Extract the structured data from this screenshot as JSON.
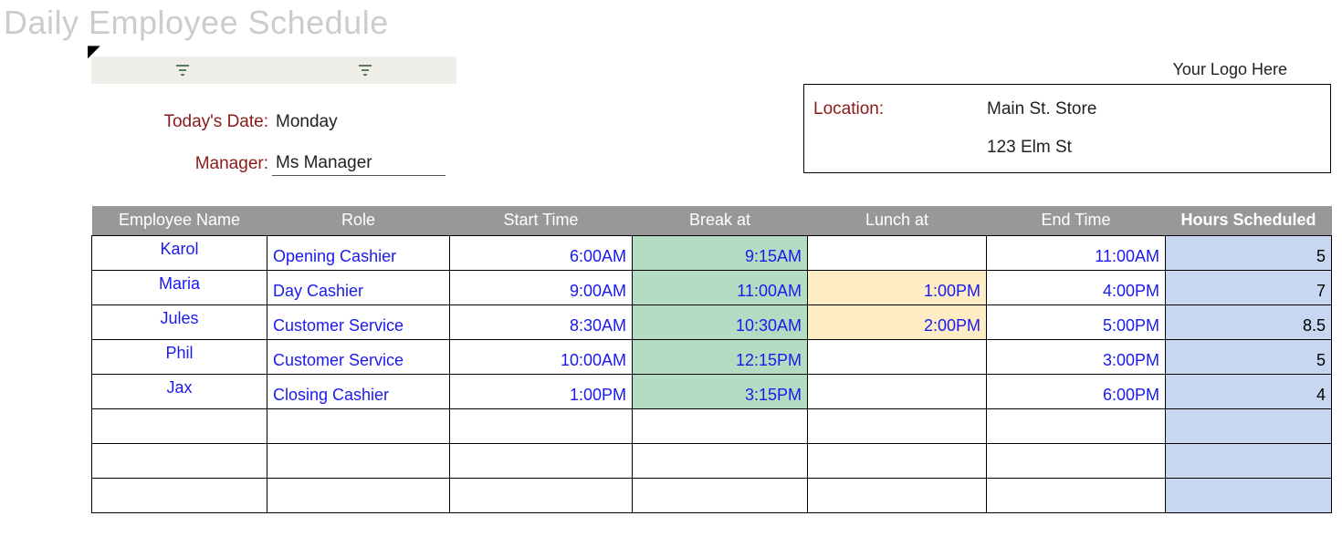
{
  "title": "Daily Employee Schedule",
  "logo_placeholder": "Your Logo Here",
  "info": {
    "date_label": "Today's Date:",
    "date_value": "Monday",
    "manager_label": "Manager:",
    "manager_value": "Ms Manager"
  },
  "location": {
    "label": "Location:",
    "name": "Main St. Store",
    "address": "123 Elm St"
  },
  "columns": {
    "name": "Employee Name",
    "role": "Role",
    "start": "Start Time",
    "break": "Break at",
    "lunch": "Lunch at",
    "end": "End Time",
    "hours": "Hours Scheduled"
  },
  "rows": [
    {
      "name": "Karol",
      "role": "Opening Cashier",
      "start": "6:00AM",
      "break": "9:15AM",
      "lunch": "",
      "end": "11:00AM",
      "hours": "5"
    },
    {
      "name": "Maria",
      "role": "Day Cashier",
      "start": "9:00AM",
      "break": "11:00AM",
      "lunch": "1:00PM",
      "end": "4:00PM",
      "hours": "7"
    },
    {
      "name": "Jules",
      "role": "Customer Service",
      "start": "8:30AM",
      "break": "10:30AM",
      "lunch": "2:00PM",
      "end": "5:00PM",
      "hours": "8.5"
    },
    {
      "name": "Phil",
      "role": "Customer Service",
      "start": "10:00AM",
      "break": "12:15PM",
      "lunch": "",
      "end": "3:00PM",
      "hours": "5"
    },
    {
      "name": "Jax",
      "role": "Closing Cashier",
      "start": "1:00PM",
      "break": "3:15PM",
      "lunch": "",
      "end": "6:00PM",
      "hours": "4"
    }
  ],
  "empty_rows": 3
}
